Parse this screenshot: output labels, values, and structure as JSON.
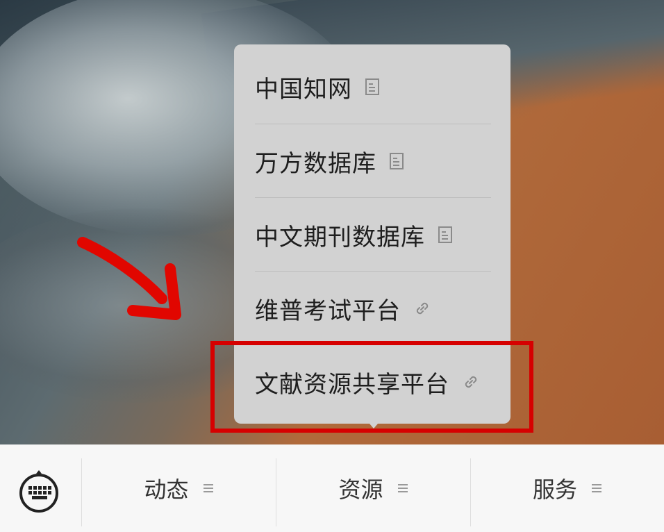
{
  "menu": {
    "items": [
      {
        "label": "中国知网",
        "icon": "document-icon"
      },
      {
        "label": "万方数据库",
        "icon": "document-icon"
      },
      {
        "label": "中文期刊数据库",
        "icon": "document-icon"
      },
      {
        "label": "维普考试平台",
        "icon": "link-icon"
      },
      {
        "label": "文献资源共享平台",
        "icon": "link-icon"
      }
    ]
  },
  "bottom_bar": {
    "tabs": [
      {
        "label": "动态",
        "icon": "menu-lines-icon"
      },
      {
        "label": "资源",
        "icon": "menu-lines-icon"
      },
      {
        "label": "服务",
        "icon": "menu-lines-icon"
      }
    ],
    "keyboard_icon": "keyboard-icon"
  },
  "colors": {
    "popup_bg": "#d2d2d2",
    "highlight_border": "#d60000",
    "arrow": "#e10600",
    "bottom_bar_bg": "#f7f7f7"
  }
}
